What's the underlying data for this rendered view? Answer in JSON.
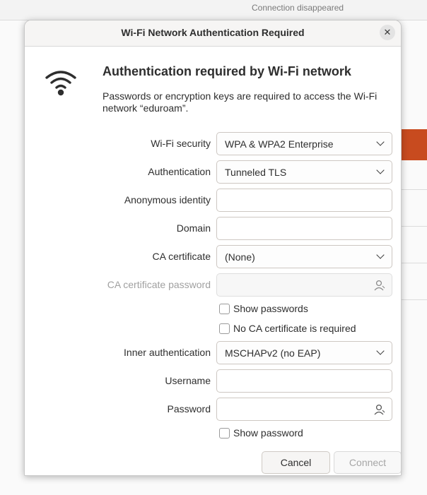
{
  "background": {
    "status_text": "Connection disappeared",
    "accent_color": "#c84b1f"
  },
  "dialog": {
    "title": "Wi-Fi Network Authentication Required",
    "close_icon": "close-icon",
    "heading": "Authentication required by Wi-Fi network",
    "description": "Passwords or encryption keys are required to access the Wi-Fi network “eduroam”.",
    "icon": "wifi-icon"
  },
  "form": {
    "wifi_security": {
      "label": "Wi-Fi security",
      "value": "WPA & WPA2 Enterprise"
    },
    "authentication": {
      "label": "Authentication",
      "value": "Tunneled TLS"
    },
    "anonymous_identity": {
      "label": "Anonymous identity",
      "value": ""
    },
    "domain": {
      "label": "Domain",
      "value": ""
    },
    "ca_certificate": {
      "label": "CA certificate",
      "value": "(None)"
    },
    "ca_certificate_password": {
      "label": "CA certificate password",
      "value": ""
    },
    "show_passwords": {
      "label": "Show passwords",
      "checked": false
    },
    "no_ca_required": {
      "label": "No CA certificate is required",
      "checked": false
    },
    "inner_authentication": {
      "label": "Inner authentication",
      "value": "MSCHAPv2 (no EAP)"
    },
    "username": {
      "label": "Username",
      "value": ""
    },
    "password": {
      "label": "Password",
      "value": ""
    },
    "show_password": {
      "label": "Show password",
      "checked": false
    }
  },
  "buttons": {
    "cancel": "Cancel",
    "connect": "Connect"
  }
}
